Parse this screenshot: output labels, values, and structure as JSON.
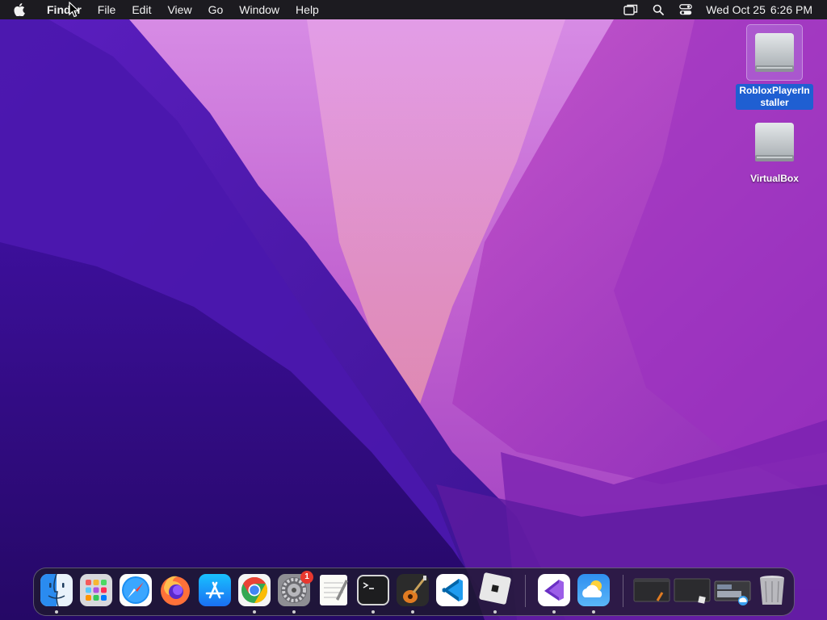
{
  "menubar": {
    "apple_icon": "apple-logo-icon",
    "app_name": "Finder",
    "items": [
      "File",
      "Edit",
      "View",
      "Go",
      "Window",
      "Help"
    ],
    "status_icons": [
      "screen-mirroring-icon",
      "spotlight-search-icon",
      "control-center-icon"
    ],
    "date": "Wed Oct 25",
    "time": "6:26 PM"
  },
  "desktop": {
    "icons": [
      {
        "label": "RobloxPlayerInstaller",
        "icon": "disk-image-icon",
        "selected": true
      },
      {
        "label": "VirtualBox",
        "icon": "disk-image-icon",
        "selected": false
      }
    ]
  },
  "dock": {
    "apps": [
      {
        "name": "Finder",
        "icon": "finder-icon",
        "running": true
      },
      {
        "name": "Launchpad",
        "icon": "launchpad-icon",
        "running": false
      },
      {
        "name": "Safari",
        "icon": "safari-icon",
        "running": false
      },
      {
        "name": "Firefox",
        "icon": "firefox-icon",
        "running": false
      },
      {
        "name": "App Store",
        "icon": "app-store-icon",
        "running": false
      },
      {
        "name": "Google Chrome",
        "icon": "chrome-icon",
        "running": true
      },
      {
        "name": "System Settings",
        "icon": "system-settings-icon",
        "running": true,
        "badge": "1"
      },
      {
        "name": "TextEdit",
        "icon": "textedit-icon",
        "running": false
      },
      {
        "name": "Terminal",
        "icon": "terminal-icon",
        "running": true
      },
      {
        "name": "GarageBand",
        "icon": "garageband-icon",
        "running": true
      },
      {
        "name": "Visual Studio Code",
        "icon": "vscode-icon",
        "running": false
      },
      {
        "name": "Roblox",
        "icon": "roblox-icon",
        "running": true
      },
      {
        "name": "Visual Studio",
        "icon": "visual-studio-icon",
        "running": true
      },
      {
        "name": "Weather",
        "icon": "weather-icon",
        "running": true
      }
    ],
    "minimized": [
      {
        "name": "Minimized window 1",
        "icon": "minimized-window-icon"
      },
      {
        "name": "Minimized window 2",
        "icon": "minimized-window-icon"
      },
      {
        "name": "Minimized window 3",
        "icon": "minimized-window-icon"
      }
    ],
    "trash": {
      "name": "Trash",
      "icon": "trash-icon"
    }
  },
  "colors": {
    "menubar_bg": "#1c1b20",
    "selection": "#1f5fd2",
    "badge": "#e8382f"
  }
}
